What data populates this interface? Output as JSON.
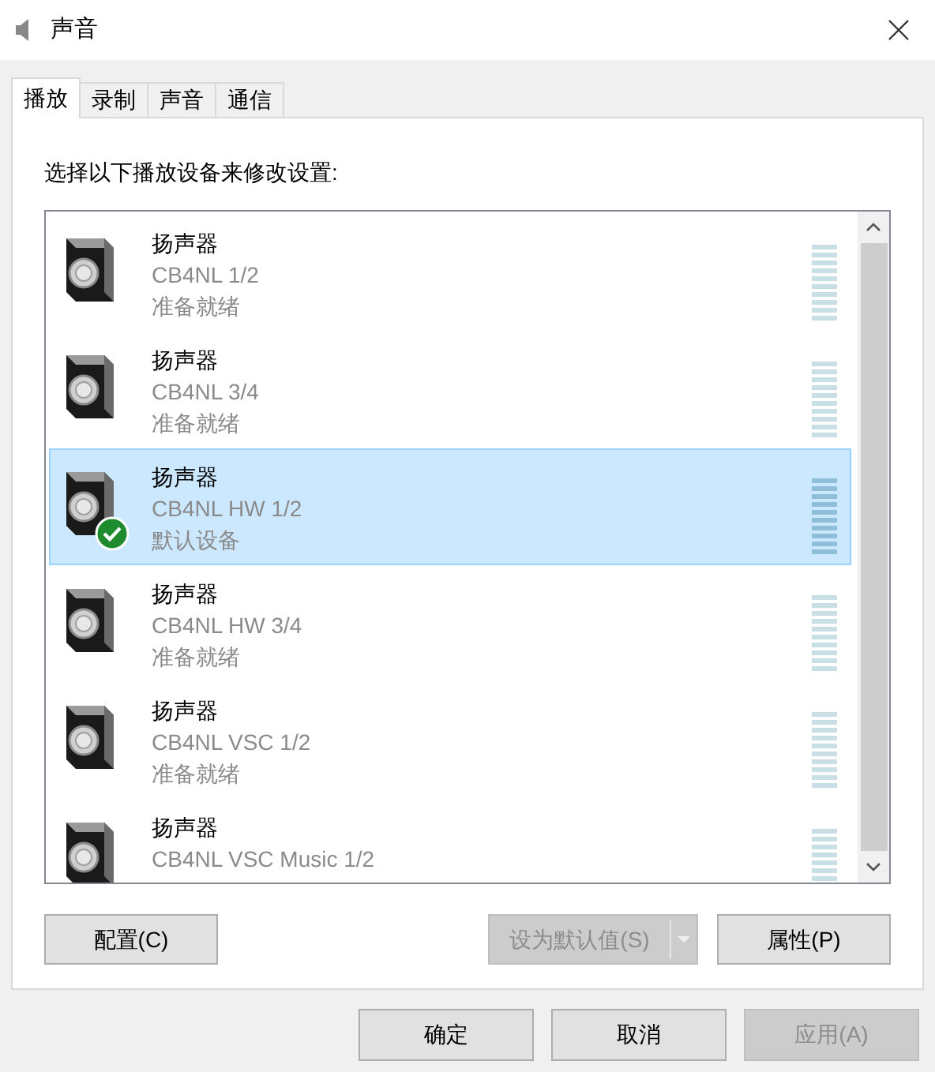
{
  "window": {
    "title": "声音"
  },
  "tabs": [
    {
      "label": "播放",
      "selected": true
    },
    {
      "label": "录制",
      "selected": false
    },
    {
      "label": "声音",
      "selected": false
    },
    {
      "label": "通信",
      "selected": false
    }
  ],
  "instruction": "选择以下播放设备来修改设置:",
  "devices": [
    {
      "name": "扬声器",
      "detail": "CB4NL 1/2",
      "status": "准备就绪",
      "selected": false,
      "default": false
    },
    {
      "name": "扬声器",
      "detail": "CB4NL 3/4",
      "status": "准备就绪",
      "selected": false,
      "default": false
    },
    {
      "name": "扬声器",
      "detail": "CB4NL HW 1/2",
      "status": "默认设备",
      "selected": true,
      "default": true
    },
    {
      "name": "扬声器",
      "detail": "CB4NL HW 3/4",
      "status": "准备就绪",
      "selected": false,
      "default": false
    },
    {
      "name": "扬声器",
      "detail": "CB4NL VSC 1/2",
      "status": "准备就绪",
      "selected": false,
      "default": false
    },
    {
      "name": "扬声器",
      "detail": "CB4NL VSC Music 1/2",
      "selected": false,
      "default": false
    }
  ],
  "panel_buttons": [
    {
      "label": "配置(C)",
      "disabled": false,
      "kind": "button"
    },
    {
      "label": "设为默认值(S)",
      "disabled": true,
      "kind": "split"
    },
    {
      "label": "属性(P)",
      "disabled": false,
      "kind": "button"
    }
  ],
  "dialog_buttons": [
    {
      "label": "确定",
      "disabled": false
    },
    {
      "label": "取消",
      "disabled": false
    },
    {
      "label": "应用(A)",
      "disabled": true
    }
  ]
}
